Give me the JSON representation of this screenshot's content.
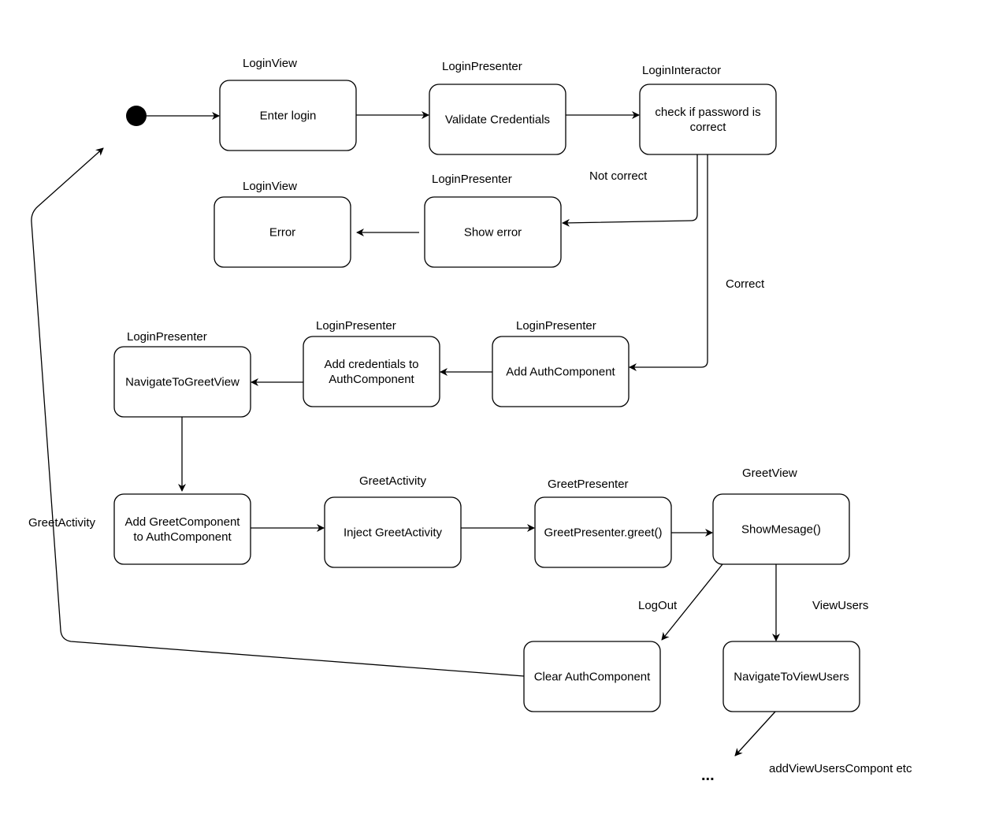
{
  "diagram": {
    "nodes": [
      {
        "id": "enter-login",
        "lines": [
          "Enter login"
        ],
        "lane": "LoginView"
      },
      {
        "id": "validate-credentials",
        "lines": [
          "Validate Credentials"
        ],
        "lane": "LoginPresenter"
      },
      {
        "id": "check-password",
        "lines": [
          "check if password is",
          "correct"
        ],
        "lane": "LoginInteractor"
      },
      {
        "id": "show-error",
        "lines": [
          "Show error"
        ],
        "lane": "LoginPresenter"
      },
      {
        "id": "error",
        "lines": [
          "Error"
        ],
        "lane": "LoginView"
      },
      {
        "id": "add-authcomponent",
        "lines": [
          "Add AuthComponent"
        ],
        "lane": "LoginPresenter"
      },
      {
        "id": "add-credentials",
        "lines": [
          "Add credentials to",
          "AuthComponent"
        ],
        "lane": "LoginPresenter"
      },
      {
        "id": "navigate-to-greetview",
        "lines": [
          "NavigateToGreetView"
        ],
        "lane": "LoginPresenter"
      },
      {
        "id": "add-greetcomponent",
        "lines": [
          "Add GreetComponent",
          "to AuthComponent"
        ],
        "lane": ""
      },
      {
        "id": "inject-greetactivity",
        "lines": [
          "Inject GreetActivity"
        ],
        "lane": "GreetActivity"
      },
      {
        "id": "greetpresenter-greet",
        "lines": [
          "GreetPresenter.greet()"
        ],
        "lane": "GreetPresenter"
      },
      {
        "id": "showmesage",
        "lines": [
          "ShowMesage()"
        ],
        "lane": "GreetView"
      },
      {
        "id": "clear-authcomponent",
        "lines": [
          "Clear AuthComponent"
        ],
        "lane": ""
      },
      {
        "id": "navigate-to-viewusers",
        "lines": [
          "NavigateToViewUsers"
        ],
        "lane": ""
      }
    ],
    "edge_labels": {
      "not_correct": "Not correct",
      "correct": "Correct",
      "greet_activity": "GreetActivity",
      "logout": "LogOut",
      "view_users": "ViewUsers",
      "add_view_users": "addViewUsersCompont etc",
      "ellipsis": "..."
    }
  }
}
